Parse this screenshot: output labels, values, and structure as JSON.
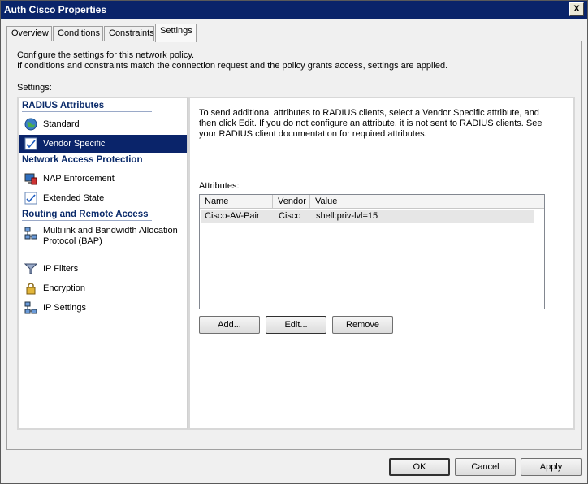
{
  "window": {
    "title": "Auth Cisco Properties",
    "close_glyph": "X"
  },
  "tabs": [
    {
      "label": "Overview",
      "active": false
    },
    {
      "label": "Conditions",
      "active": false
    },
    {
      "label": "Constraints",
      "active": false
    },
    {
      "label": "Settings",
      "active": true
    }
  ],
  "intro": {
    "line1": "Configure the settings for this network policy.",
    "line2": "If conditions and constraints match the connection request and the policy grants access, settings are applied."
  },
  "settings_label": "Settings:",
  "nav": {
    "categories": [
      {
        "title": "RADIUS Attributes",
        "items": [
          {
            "label": "Standard",
            "icon": "globe-icon",
            "selected": false
          },
          {
            "label": "Vendor Specific",
            "icon": "checklist-icon",
            "selected": true
          }
        ]
      },
      {
        "title": "Network Access Protection",
        "items": [
          {
            "label": "NAP Enforcement",
            "icon": "nap-monitor-icon",
            "selected": false
          },
          {
            "label": "Extended State",
            "icon": "checklist-icon",
            "selected": false
          }
        ]
      },
      {
        "title": "Routing and Remote Access",
        "items": [
          {
            "label": "Multilink and Bandwidth Allocation Protocol (BAP)",
            "icon": "network-icon",
            "selected": false
          },
          {
            "label": "IP Filters",
            "icon": "funnel-icon",
            "selected": false
          },
          {
            "label": "Encryption",
            "icon": "lock-icon",
            "selected": false
          },
          {
            "label": "IP Settings",
            "icon": "network-icon",
            "selected": false
          }
        ]
      }
    ]
  },
  "content": {
    "description": "To send additional attributes to RADIUS clients, select a Vendor Specific attribute, and then click Edit. If you do not configure an attribute, it is not sent to RADIUS clients. See your RADIUS client documentation for required attributes.",
    "attributes_label": "Attributes:",
    "columns": [
      "Name",
      "Vendor",
      "Value"
    ],
    "rows": [
      {
        "name": "Cisco-AV-Pair",
        "vendor": "Cisco",
        "value": "shell:priv-lvl=15"
      }
    ],
    "buttons": {
      "add": "Add...",
      "edit": "Edit...",
      "remove": "Remove"
    }
  },
  "footer": {
    "ok": "OK",
    "cancel": "Cancel",
    "apply": "Apply"
  },
  "colors": {
    "titlebar": "#0a246a",
    "selection": "#0a246a",
    "category_text": "#0a2a6a"
  }
}
